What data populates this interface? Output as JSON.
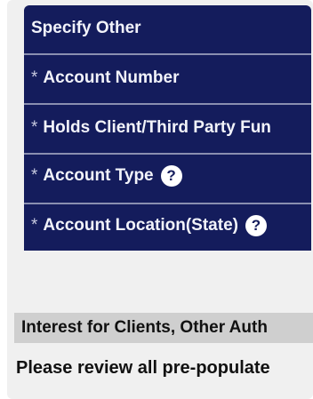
{
  "form_labels": [
    {
      "prefix": "",
      "label": "Specify Other",
      "help": ""
    },
    {
      "prefix": "*",
      "label": "Account Number",
      "help": ""
    },
    {
      "prefix": "*",
      "label": "Holds Client/Third Party Fun",
      "help": ""
    },
    {
      "prefix": "*",
      "label": "Account Type",
      "help": "?"
    },
    {
      "prefix": "*",
      "label": "Account Location(State)",
      "help": "?"
    }
  ],
  "section_header": "Interest for Clients, Other Auth",
  "notice_text": "Please review all pre-populate",
  "colors": {
    "panel_bg": "#141c5c",
    "label_text": "#f2f3fa",
    "section_bg": "#cfcfcf",
    "card_bg": "#f0f0f0"
  }
}
